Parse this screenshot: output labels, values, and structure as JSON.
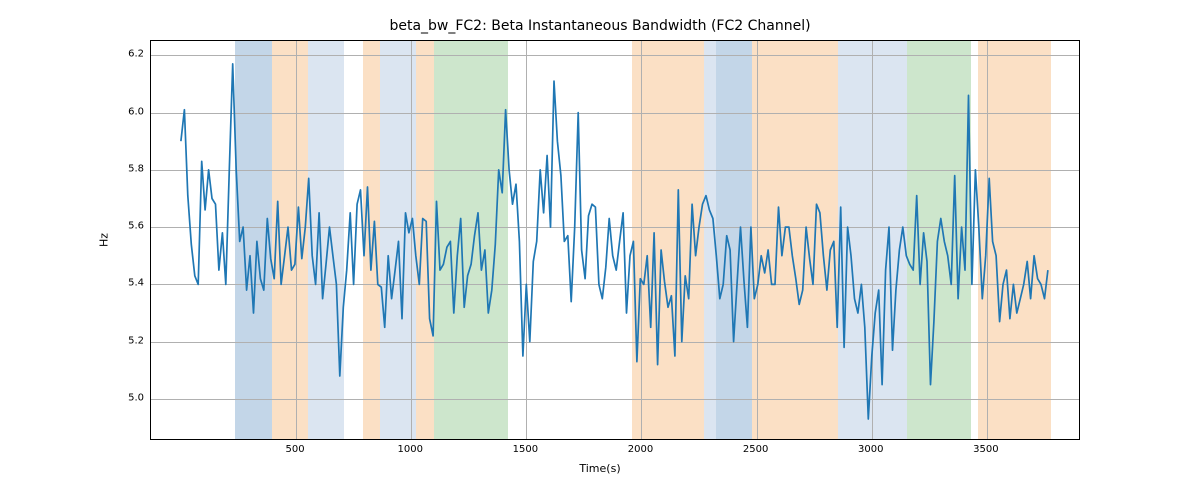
{
  "chart_data": {
    "type": "line",
    "title": "beta_bw_FC2: Beta Instantaneous Bandwidth (FC2 Channel)",
    "xlabel": "Time(s)",
    "ylabel": "Hz",
    "x_ticks": [
      500,
      1000,
      1500,
      2000,
      2500,
      3000,
      3500
    ],
    "y_ticks": [
      5.0,
      5.2,
      5.4,
      5.6,
      5.8,
      6.0,
      6.2
    ],
    "xlim": [
      -130,
      3900
    ],
    "ylim": [
      4.86,
      6.25
    ],
    "bands": [
      {
        "start": 235,
        "end": 395,
        "color": "blue"
      },
      {
        "start": 395,
        "end": 550,
        "color": "orange"
      },
      {
        "start": 550,
        "end": 710,
        "color": "lblue"
      },
      {
        "start": 790,
        "end": 1100,
        "color": "orange"
      },
      {
        "start": 865,
        "end": 1020,
        "color": "lblue"
      },
      {
        "start": 1100,
        "end": 1420,
        "color": "green"
      },
      {
        "start": 1960,
        "end": 2270,
        "color": "orange"
      },
      {
        "start": 2270,
        "end": 2480,
        "color": "lblue"
      },
      {
        "start": 2325,
        "end": 2480,
        "color": "blue"
      },
      {
        "start": 2480,
        "end": 2855,
        "color": "orange"
      },
      {
        "start": 2855,
        "end": 3155,
        "color": "lblue"
      },
      {
        "start": 3155,
        "end": 3430,
        "color": "green"
      },
      {
        "start": 3460,
        "end": 3780,
        "color": "orange"
      }
    ],
    "series": [
      {
        "name": "beta_bw_FC2",
        "color": "#1f77b4",
        "x_step": 15,
        "x_start": 0,
        "values": [
          5.9,
          6.01,
          5.71,
          5.54,
          5.43,
          5.4,
          5.83,
          5.66,
          5.8,
          5.7,
          5.68,
          5.45,
          5.58,
          5.4,
          5.8,
          6.17,
          5.8,
          5.55,
          5.6,
          5.38,
          5.5,
          5.3,
          5.55,
          5.42,
          5.38,
          5.63,
          5.49,
          5.42,
          5.69,
          5.4,
          5.5,
          5.6,
          5.45,
          5.47,
          5.67,
          5.49,
          5.6,
          5.77,
          5.5,
          5.4,
          5.65,
          5.35,
          5.47,
          5.6,
          5.5,
          5.4,
          5.08,
          5.32,
          5.45,
          5.65,
          5.4,
          5.68,
          5.73,
          5.5,
          5.74,
          5.45,
          5.62,
          5.4,
          5.39,
          5.25,
          5.5,
          5.35,
          5.45,
          5.55,
          5.28,
          5.65,
          5.58,
          5.63,
          5.5,
          5.4,
          5.63,
          5.62,
          5.28,
          5.22,
          5.69,
          5.45,
          5.47,
          5.53,
          5.55,
          5.3,
          5.5,
          5.63,
          5.32,
          5.43,
          5.47,
          5.57,
          5.65,
          5.45,
          5.52,
          5.3,
          5.38,
          5.54,
          5.8,
          5.72,
          6.01,
          5.8,
          5.68,
          5.75,
          5.55,
          5.15,
          5.4,
          5.2,
          5.48,
          5.55,
          5.8,
          5.65,
          5.85,
          5.6,
          6.11,
          5.9,
          5.78,
          5.55,
          5.57,
          5.34,
          5.6,
          6.0,
          5.52,
          5.42,
          5.64,
          5.68,
          5.67,
          5.4,
          5.35,
          5.46,
          5.63,
          5.5,
          5.45,
          5.55,
          5.65,
          5.3,
          5.5,
          5.55,
          5.13,
          5.42,
          5.4,
          5.5,
          5.25,
          5.58,
          5.12,
          5.52,
          5.41,
          5.32,
          5.36,
          5.15,
          5.73,
          5.2,
          5.43,
          5.35,
          5.68,
          5.5,
          5.6,
          5.68,
          5.71,
          5.66,
          5.63,
          5.5,
          5.35,
          5.4,
          5.57,
          5.52,
          5.2,
          5.4,
          5.6,
          5.41,
          5.25,
          5.6,
          5.35,
          5.4,
          5.5,
          5.44,
          5.52,
          5.4,
          5.4,
          5.67,
          5.5,
          5.6,
          5.6,
          5.5,
          5.42,
          5.33,
          5.38,
          5.6,
          5.49,
          5.4,
          5.68,
          5.65,
          5.5,
          5.38,
          5.52,
          5.55,
          5.25,
          5.67,
          5.18,
          5.6,
          5.5,
          5.35,
          5.3,
          5.4,
          5.25,
          4.93,
          5.15,
          5.3,
          5.38,
          5.05,
          5.45,
          5.6,
          5.17,
          5.38,
          5.52,
          5.6,
          5.5,
          5.47,
          5.45,
          5.71,
          5.4,
          5.58,
          5.48,
          5.05,
          5.27,
          5.55,
          5.63,
          5.55,
          5.5,
          5.4,
          5.78,
          5.35,
          5.6,
          5.45,
          6.06,
          5.4,
          5.8,
          5.6,
          5.35,
          5.5,
          5.77,
          5.55,
          5.5,
          5.27,
          5.4,
          5.45,
          5.28,
          5.4,
          5.3,
          5.35,
          5.4,
          5.48,
          5.35,
          5.5,
          5.42,
          5.4,
          5.35,
          5.45
        ]
      }
    ]
  }
}
